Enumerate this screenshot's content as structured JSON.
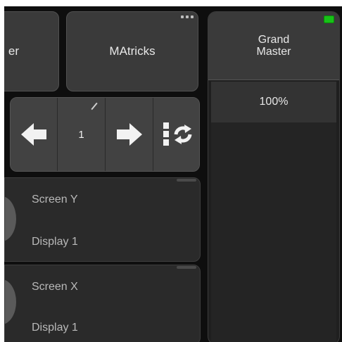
{
  "top_tiles": {
    "left_partial_label": "er",
    "matricks_label": "MAtricks"
  },
  "grand_master": {
    "title_line1": "Grand",
    "title_line2": "Master",
    "value": "100%",
    "led_color": "#17c117"
  },
  "navigation": {
    "page_value": "1",
    "left_icon": "arrow-left-icon",
    "right_icon": "arrow-right-icon",
    "cycle_icon": "cycle-icon"
  },
  "panels": [
    {
      "line1": "Screen Y",
      "line2": "Display 1"
    },
    {
      "line1": "Screen X",
      "line2": "Display 1"
    }
  ]
}
